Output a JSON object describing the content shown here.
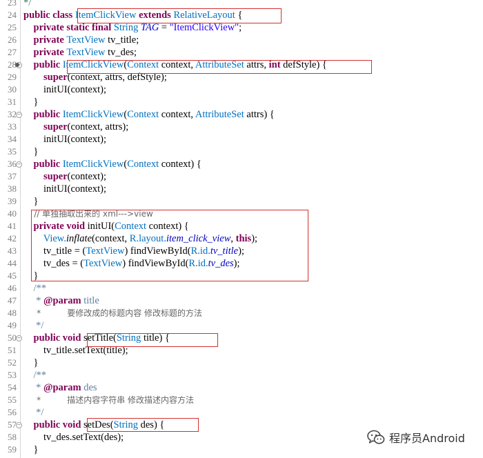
{
  "lines": [
    {
      "n": "23",
      "parts": [
        {
          "t": "*/",
          "c": "cm"
        }
      ]
    },
    {
      "n": "24",
      "parts": [
        {
          "t": "public class ",
          "c": "kw"
        },
        {
          "t": "ItemClickView",
          "c": "ty"
        },
        {
          "t": " extends ",
          "c": "kw"
        },
        {
          "t": "RelativeLayout",
          "c": "ty"
        },
        {
          "t": " {",
          "c": ""
        }
      ]
    },
    {
      "n": "25",
      "parts": [
        {
          "t": "    private static final ",
          "c": "kw"
        },
        {
          "t": "String",
          "c": "ty"
        },
        {
          "t": " ",
          "c": ""
        },
        {
          "t": "TAG",
          "c": "fl it"
        },
        {
          "t": " = ",
          "c": ""
        },
        {
          "t": "\"ItemClickView\"",
          "c": "st"
        },
        {
          "t": ";",
          "c": ""
        }
      ]
    },
    {
      "n": "26",
      "parts": [
        {
          "t": "    private ",
          "c": "kw"
        },
        {
          "t": "TextView",
          "c": "ty"
        },
        {
          "t": " tv_title;",
          "c": ""
        }
      ]
    },
    {
      "n": "27",
      "parts": [
        {
          "t": "    private ",
          "c": "kw"
        },
        {
          "t": "TextView",
          "c": "ty"
        },
        {
          "t": " tv_des;",
          "c": ""
        }
      ]
    },
    {
      "n": "28",
      "parts": [
        {
          "t": "    public ",
          "c": "kw"
        },
        {
          "t": "ItemClickView",
          "c": "ty"
        },
        {
          "t": "(",
          "c": ""
        },
        {
          "t": "Context",
          "c": "ty"
        },
        {
          "t": " context, ",
          "c": ""
        },
        {
          "t": "AttributeSet",
          "c": "ty"
        },
        {
          "t": " attrs, ",
          "c": ""
        },
        {
          "t": "int",
          "c": "kw"
        },
        {
          "t": " defStyle) {",
          "c": ""
        }
      ]
    },
    {
      "n": "29",
      "parts": [
        {
          "t": "        super",
          "c": "kw"
        },
        {
          "t": "(context, attrs, defStyle);",
          "c": ""
        }
      ]
    },
    {
      "n": "30",
      "parts": [
        {
          "t": "        initUI(context);",
          "c": ""
        }
      ]
    },
    {
      "n": "31",
      "parts": [
        {
          "t": "    }",
          "c": ""
        }
      ]
    },
    {
      "n": "32",
      "parts": [
        {
          "t": "    public ",
          "c": "kw"
        },
        {
          "t": "ItemClickView",
          "c": "ty"
        },
        {
          "t": "(",
          "c": ""
        },
        {
          "t": "Context",
          "c": "ty"
        },
        {
          "t": " context, ",
          "c": ""
        },
        {
          "t": "AttributeSet",
          "c": "ty"
        },
        {
          "t": " attrs) {",
          "c": ""
        }
      ]
    },
    {
      "n": "33",
      "parts": [
        {
          "t": "        super",
          "c": "kw"
        },
        {
          "t": "(context, attrs);",
          "c": ""
        }
      ]
    },
    {
      "n": "34",
      "parts": [
        {
          "t": "        initUI(context);",
          "c": ""
        }
      ]
    },
    {
      "n": "35",
      "parts": [
        {
          "t": "    }",
          "c": ""
        }
      ]
    },
    {
      "n": "36",
      "parts": [
        {
          "t": "    public ",
          "c": "kw"
        },
        {
          "t": "ItemClickView",
          "c": "ty"
        },
        {
          "t": "(",
          "c": ""
        },
        {
          "t": "Context",
          "c": "ty"
        },
        {
          "t": " context) {",
          "c": ""
        }
      ]
    },
    {
      "n": "37",
      "parts": [
        {
          "t": "        super",
          "c": "kw"
        },
        {
          "t": "(context);",
          "c": ""
        }
      ]
    },
    {
      "n": "38",
      "parts": [
        {
          "t": "        initUI(context);",
          "c": ""
        }
      ]
    },
    {
      "n": "39",
      "parts": [
        {
          "t": "    }",
          "c": ""
        }
      ]
    },
    {
      "n": "40",
      "parts": [
        {
          "t": "    // 单独抽取出来的 xml--->view",
          "c": "cm"
        }
      ]
    },
    {
      "n": "41",
      "parts": [
        {
          "t": "    private void ",
          "c": "kw"
        },
        {
          "t": "initUI",
          "c": "md"
        },
        {
          "t": "(",
          "c": ""
        },
        {
          "t": "Context",
          "c": "ty"
        },
        {
          "t": " context) {",
          "c": ""
        }
      ]
    },
    {
      "n": "42",
      "parts": [
        {
          "t": "        View.",
          "c": "ty"
        },
        {
          "t": "inflate",
          "c": "it"
        },
        {
          "t": "(context, ",
          "c": ""
        },
        {
          "t": "R.layout.",
          "c": "ty"
        },
        {
          "t": "item_click_view",
          "c": "fl it"
        },
        {
          "t": ", ",
          "c": ""
        },
        {
          "t": "this",
          "c": "kw"
        },
        {
          "t": ");",
          "c": ""
        }
      ]
    },
    {
      "n": "43",
      "parts": [
        {
          "t": "        tv_title = (",
          "c": ""
        },
        {
          "t": "TextView",
          "c": "ty"
        },
        {
          "t": ") findViewById(",
          "c": ""
        },
        {
          "t": "R.id.",
          "c": "ty"
        },
        {
          "t": "tv_title",
          "c": "fl it"
        },
        {
          "t": ");",
          "c": ""
        }
      ]
    },
    {
      "n": "44",
      "parts": [
        {
          "t": "        tv_des = (",
          "c": ""
        },
        {
          "t": "TextView",
          "c": "ty"
        },
        {
          "t": ") findViewById(",
          "c": ""
        },
        {
          "t": "R.id.",
          "c": "ty"
        },
        {
          "t": "tv_des",
          "c": "fl it"
        },
        {
          "t": ");",
          "c": ""
        }
      ]
    },
    {
      "n": "45",
      "parts": [
        {
          "t": "    }",
          "c": ""
        }
      ]
    },
    {
      "n": "46",
      "parts": [
        {
          "t": "    /**",
          "c": "cm2"
        }
      ]
    },
    {
      "n": "47",
      "parts": [
        {
          "t": "     * ",
          "c": "cm2"
        },
        {
          "t": "@param",
          "c": "kw"
        },
        {
          "t": " title",
          "c": "cm2"
        }
      ]
    },
    {
      "n": "48",
      "parts": [
        {
          "t": "     *          要修改成的标题内容 修改标题的方法",
          "c": "cm2"
        }
      ]
    },
    {
      "n": "49",
      "parts": [
        {
          "t": "     */",
          "c": "cm2"
        }
      ]
    },
    {
      "n": "50",
      "parts": [
        {
          "t": "    public void ",
          "c": "kw"
        },
        {
          "t": "setTitle",
          "c": "md"
        },
        {
          "t": "(",
          "c": ""
        },
        {
          "t": "String",
          "c": "ty"
        },
        {
          "t": " title) {",
          "c": ""
        }
      ]
    },
    {
      "n": "51",
      "parts": [
        {
          "t": "        tv_title.setText(title);",
          "c": ""
        }
      ]
    },
    {
      "n": "52",
      "parts": [
        {
          "t": "    }",
          "c": ""
        }
      ]
    },
    {
      "n": "53",
      "parts": [
        {
          "t": "    /**",
          "c": "cm2"
        }
      ]
    },
    {
      "n": "54",
      "parts": [
        {
          "t": "     * ",
          "c": "cm2"
        },
        {
          "t": "@param",
          "c": "kw"
        },
        {
          "t": " des",
          "c": "cm2"
        }
      ]
    },
    {
      "n": "55",
      "parts": [
        {
          "t": "     *          描述内容字符串 修改描述内容方法",
          "c": "cm2"
        }
      ]
    },
    {
      "n": "56",
      "parts": [
        {
          "t": "     */",
          "c": "cm2"
        }
      ]
    },
    {
      "n": "57",
      "parts": [
        {
          "t": "    public void ",
          "c": "kw"
        },
        {
          "t": "setDes",
          "c": "md"
        },
        {
          "t": "(",
          "c": ""
        },
        {
          "t": "String",
          "c": "ty"
        },
        {
          "t": " des) {",
          "c": ""
        }
      ]
    },
    {
      "n": "58",
      "parts": [
        {
          "t": "        tv_des.setText(des);",
          "c": ""
        }
      ]
    },
    {
      "n": "59",
      "parts": [
        {
          "t": "    }",
          "c": ""
        }
      ]
    }
  ],
  "fold_lines": [
    "28",
    "32",
    "36",
    "50",
    "57"
  ],
  "breakpoint_lines": [
    "28"
  ],
  "watermark": {
    "text": "程序员Android",
    "icon": "wechat-icon"
  },
  "colors": {
    "highlight_box": "#d32f2f",
    "keyword": "#7f0055",
    "type": "#0070c0",
    "string": "#2a00ff"
  }
}
